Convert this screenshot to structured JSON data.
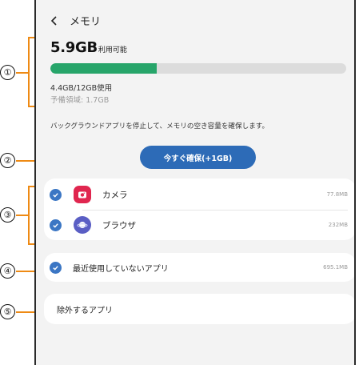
{
  "header": {
    "title": "メモリ"
  },
  "memory": {
    "available_value": "5.9GB",
    "available_label": "利用可能",
    "used_fraction": 0.36,
    "used_text": "4.4GB/12GB使用",
    "reserved_text": "予備領域: 1.7GB"
  },
  "description": "バックグラウンドアプリを停止して、メモリの空き容量を確保します。",
  "free_button": "今すぐ確保(+1GB)",
  "apps": [
    {
      "name": "カメラ",
      "size": "77.8MB",
      "checked": true
    },
    {
      "name": "ブラウザ",
      "size": "232MB",
      "checked": true
    }
  ],
  "unused": {
    "label": "最近使用していないアプリ",
    "size": "695.1MB",
    "checked": true
  },
  "exclude": {
    "label": "除外するアプリ"
  },
  "annotations": [
    "①",
    "②",
    "③",
    "④",
    "⑤"
  ],
  "colors": {
    "bar_fill": "#27a56a",
    "button": "#2d6bb7",
    "check": "#3b76c4",
    "annotation": "#ee8a14"
  }
}
